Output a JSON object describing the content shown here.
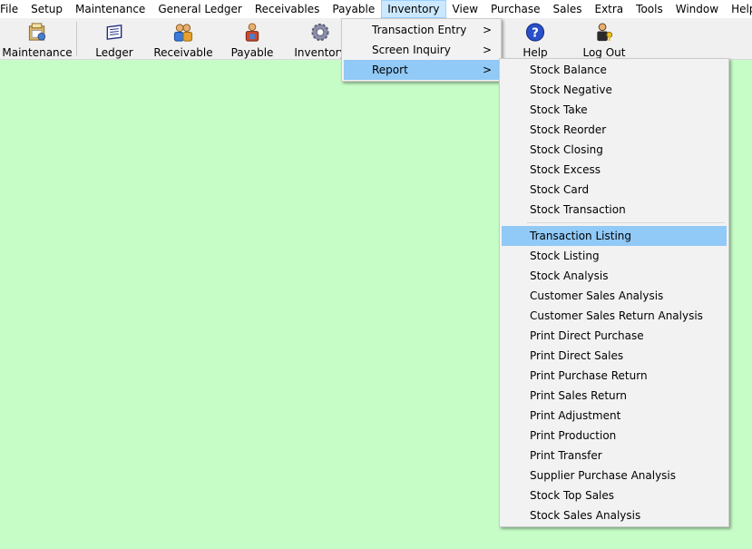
{
  "menubar": [
    "File",
    "Setup",
    "Maintenance",
    "General Ledger",
    "Receivables",
    "Payable",
    "Inventory",
    "View",
    "Purchase",
    "Sales",
    "Extra",
    "Tools",
    "Window",
    "Help"
  ],
  "active_menu": "Inventory",
  "toolbar": {
    "maintenance": "Maintenance",
    "ledger": "Ledger",
    "receivable": "Receivable",
    "payable": "Payable",
    "inventory": "Inventory",
    "help": "Help",
    "logout": "Log Out"
  },
  "inventory_menu": {
    "items": [
      {
        "label": "Transaction Entry",
        "arrow": ">"
      },
      {
        "label": "Screen Inquiry",
        "arrow": ">"
      },
      {
        "label": "Report",
        "arrow": ">"
      }
    ],
    "highlighted": "Report"
  },
  "report_submenu": {
    "group1": [
      "Stock Balance",
      "Stock Negative",
      "Stock Take",
      "Stock Reorder",
      "Stock Closing",
      "Stock Excess",
      "Stock Card",
      "Stock Transaction"
    ],
    "group2": [
      "Transaction Listing",
      "Stock Listing",
      "Stock Analysis",
      "Customer Sales Analysis",
      "Customer Sales Return Analysis",
      "Print Direct Purchase",
      "Print Direct Sales",
      "Print Purchase Return",
      "Print Sales Return",
      "Print Adjustment",
      "Print Production",
      "Print Transfer",
      "Supplier Purchase Analysis",
      "Stock Top Sales",
      "Stock Sales Analysis"
    ],
    "highlighted": "Transaction Listing"
  },
  "colors": {
    "workspace": "#c6fdc6",
    "highlight": "#91c9f7",
    "menu_active": "#cce8ff"
  }
}
